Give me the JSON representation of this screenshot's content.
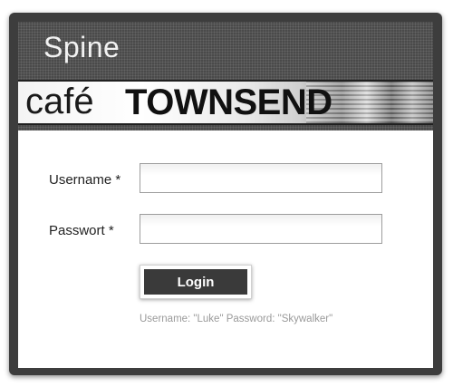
{
  "header": {
    "title": "Spine",
    "brand_light": "café",
    "brand_bold": "TOWNSEND"
  },
  "form": {
    "username_label": "Username *",
    "password_label": "Passwort *",
    "username_value": "",
    "password_value": "",
    "login_label": "Login",
    "hint": "Username: \"Luke\" Password: \"Skywalker\""
  }
}
